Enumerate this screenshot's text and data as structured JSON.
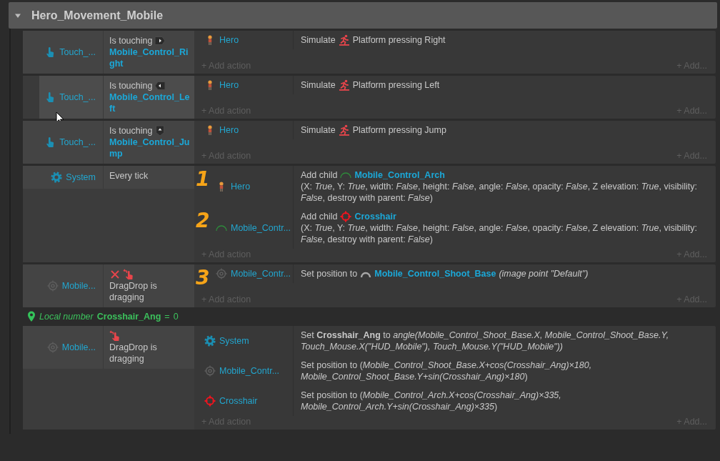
{
  "group": {
    "title": "Hero_Movement_Mobile",
    "expanded": true
  },
  "events": [
    {
      "kind": "event",
      "highlighted": false,
      "conditions": [
        {
          "object": {
            "kind": "touch",
            "name": "Touch_..."
          },
          "inverted": false,
          "text_before": "Is touching",
          "param": {
            "kind": "button-right",
            "name": "Mobile_Control_Right"
          }
        }
      ],
      "actions": [
        {
          "object": {
            "kind": "hero",
            "name": "Hero"
          },
          "text_before": "Simulate",
          "param": {
            "kind": "platform"
          },
          "text": "Platform pressing Right"
        }
      ],
      "add_action": "+ Add action",
      "add_more": "+ Add..."
    },
    {
      "kind": "event",
      "highlighted": true,
      "conditions": [
        {
          "object": {
            "kind": "touch",
            "name": "Touch_..."
          },
          "inverted": false,
          "text_before": "Is touching",
          "param": {
            "kind": "button-left",
            "name": "Mobile_Control_Left"
          }
        }
      ],
      "actions": [
        {
          "object": {
            "kind": "hero",
            "name": "Hero"
          },
          "text_before": "Simulate",
          "param": {
            "kind": "platform"
          },
          "text": "Platform pressing Left"
        }
      ],
      "add_action": "+ Add action",
      "add_more": "+ Add..."
    },
    {
      "kind": "event",
      "highlighted": false,
      "conditions": [
        {
          "object": {
            "kind": "touch",
            "name": "Touch_..."
          },
          "inverted": false,
          "text_before": "Is touching",
          "param": {
            "kind": "button-up",
            "name": "Mobile_Control_Jump"
          }
        }
      ],
      "actions": [
        {
          "object": {
            "kind": "hero",
            "name": "Hero"
          },
          "text_before": "Simulate",
          "param": {
            "kind": "platform"
          },
          "text": "Platform pressing Jump"
        }
      ],
      "add_action": "+ Add action",
      "add_more": "+ Add..."
    },
    {
      "kind": "event",
      "highlighted": false,
      "conditions": [
        {
          "object": {
            "kind": "gear",
            "name": "System"
          },
          "inverted": false,
          "text": "Every tick"
        }
      ],
      "actions": [
        {
          "object": {
            "kind": "hero",
            "name": "Hero"
          },
          "text_before": "Add child",
          "param": {
            "kind": "arch",
            "name": "Mobile_Control_Arch"
          },
          "text": "(X: *True*, Y: *True*, width: *False*, height: *False*, angle: *False*, opacity: *False*, Z elevation: *True*, visibility: *False*, destroy with parent: *False*)",
          "mark": "1"
        },
        {
          "object": {
            "kind": "arch",
            "name": "Mobile_Contr..."
          },
          "text_before": "Add child",
          "param": {
            "kind": "crosshair",
            "name": "Crosshair"
          },
          "text": "(X: *True*, Y: *True*, width: *False*, height: *False*, angle: *False*, opacity: *False*, Z elevation: *True*, visibility: *False*, destroy with parent: *False*)",
          "mark": "2"
        }
      ],
      "add_action": "+ Add action",
      "add_more": "+ Add..."
    },
    {
      "kind": "event",
      "highlighted": false,
      "conditions": [
        {
          "object": {
            "kind": "target",
            "name": "Mobile..."
          },
          "inverted": true,
          "param": {
            "kind": "dragdrop"
          },
          "text": "DragDrop is dragging"
        }
      ],
      "actions": [
        {
          "object": {
            "kind": "target",
            "name": "Mobile_Contr..."
          },
          "text_before": "Set position to",
          "param": {
            "kind": "shoot-base",
            "name": "Mobile_Control_Shoot_Base"
          },
          "text": "*(image point \"Default\")*",
          "mark": "3"
        }
      ],
      "add_action": "+ Add action",
      "add_more": "+ Add..."
    },
    {
      "kind": "variable",
      "label": "Local number",
      "name": "Crosshair_Ang",
      "operator": "=",
      "value": "0"
    },
    {
      "kind": "event",
      "highlighted": false,
      "conditions": [
        {
          "object": {
            "kind": "target",
            "name": "Mobile..."
          },
          "inverted": false,
          "param": {
            "kind": "dragdrop"
          },
          "text": "DragDrop is dragging"
        }
      ],
      "actions": [
        {
          "object": {
            "kind": "gear",
            "name": "System"
          },
          "text": "Set **Crosshair_Ang** to *angle(Mobile_Control_Shoot_Base.X, Mobile_Control_Shoot_Base.Y, Touch_Mouse.X(\"HUD_Mobile\"), Touch_Mouse.Y(\"HUD_Mobile\"))*"
        },
        {
          "object": {
            "kind": "target",
            "name": "Mobile_Contr..."
          },
          "text": "Set position to (*Mobile_Control_Shoot_Base.X+cos(Crosshair_Ang)×180, Mobile_Control_Shoot_Base.Y+sin(Crosshair_Ang)×180*)"
        },
        {
          "object": {
            "kind": "crosshair",
            "name": "Crosshair"
          },
          "text": "Set position to (*Mobile_Control_Arch.X+cos(Crosshair_Ang)×335, Mobile_Control_Arch.Y+sin(Crosshair_Ang)×335*)"
        }
      ],
      "add_action": "+ Add action",
      "add_more": "+ Add..."
    }
  ]
}
